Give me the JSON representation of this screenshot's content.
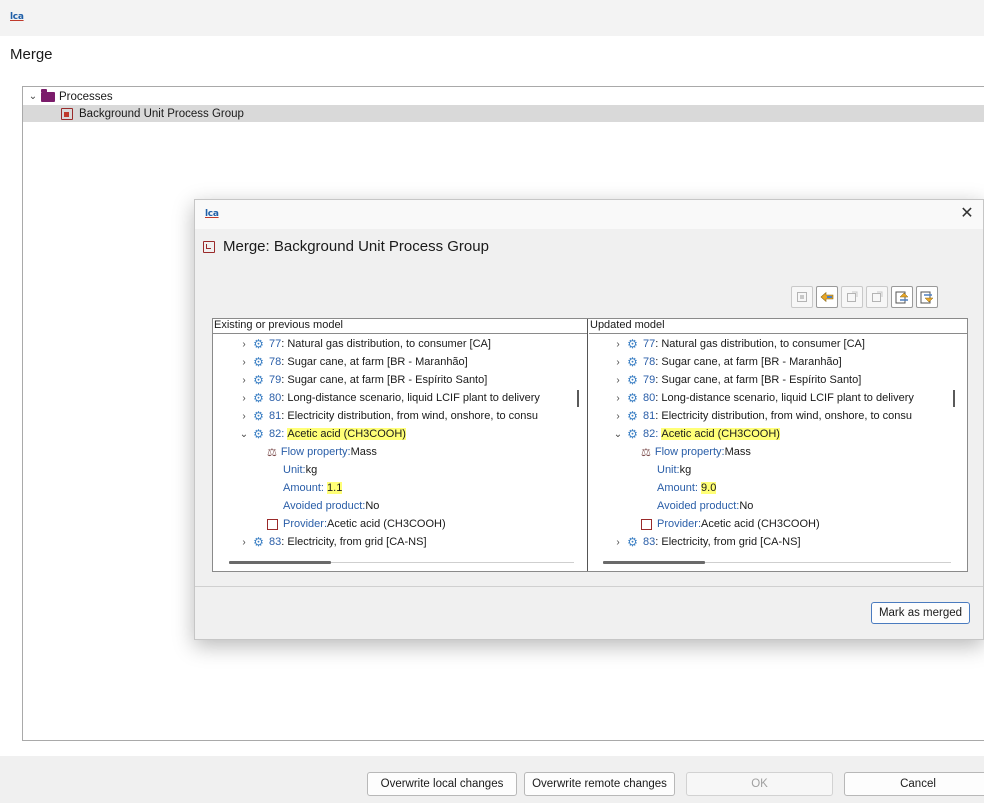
{
  "app": {
    "logo_text": "lca",
    "window_title": "Merge"
  },
  "tree": {
    "root_label": "Processes",
    "child_label": "Background Unit Process Group"
  },
  "dialog": {
    "logo_text": "lca",
    "close_glyph": "✕",
    "title": "Merge: Background Unit Process Group",
    "mark_as_merged_label": "Mark as merged",
    "toolbar_icons": [
      "copy-selection-icon",
      "copy-left-icon",
      "copy-all-right-icon",
      "copy-all-left-icon",
      "next-difference-icon",
      "previous-difference-icon"
    ]
  },
  "compare": {
    "left_header": "Existing or previous model",
    "right_header": "Updated model",
    "left": {
      "rows": [
        {
          "id": "77",
          "text": ": Natural gas distribution, to consumer [CA]"
        },
        {
          "id": "78",
          "text": ": Sugar cane, at farm [BR - Maranhão]"
        },
        {
          "id": "79",
          "text": ": Sugar cane, at farm [BR - Espírito Santo]"
        },
        {
          "id": "80",
          "text": ": Long-distance scenario, liquid LCIF plant to delivery"
        },
        {
          "id": "81",
          "text": ": Electricity distribution, from wind, onshore, to consu"
        },
        {
          "id": "82",
          "text": "Acetic acid (CH3COOH)"
        },
        {
          "id": "83",
          "text": ": Electricity, from grid [CA-NS]"
        }
      ],
      "flow_property_label": "Flow property:",
      "flow_property_value": " Mass",
      "unit_label": "Unit:",
      "unit_value": " kg",
      "amount_label": "Amount:",
      "amount_value": "1.1",
      "avoided_label": "Avoided product:",
      "avoided_value": " No",
      "provider_label": "Provider:",
      "provider_value": " Acetic acid (CH3COOH)"
    },
    "right": {
      "rows": [
        {
          "id": "77",
          "text": ": Natural gas distribution, to consumer [CA]"
        },
        {
          "id": "78",
          "text": ": Sugar cane, at farm [BR - Maranhão]"
        },
        {
          "id": "79",
          "text": ": Sugar cane, at farm [BR - Espírito Santo]"
        },
        {
          "id": "80",
          "text": ": Long-distance scenario, liquid LCIF plant to delivery"
        },
        {
          "id": "81",
          "text": ": Electricity distribution, from wind, onshore, to consu"
        },
        {
          "id": "82",
          "text": "Acetic acid (CH3COOH)"
        },
        {
          "id": "83",
          "text": ": Electricity, from grid [CA-NS]"
        }
      ],
      "flow_property_label": "Flow property:",
      "flow_property_value": " Mass",
      "unit_label": "Unit:",
      "unit_value": " kg",
      "amount_label": "Amount:",
      "amount_value": "9.0",
      "avoided_label": "Avoided product:",
      "avoided_value": " No",
      "provider_label": "Provider:",
      "provider_value": " Acetic acid (CH3COOH)"
    }
  },
  "buttons": {
    "overwrite_local": "Overwrite local changes",
    "overwrite_remote": "Overwrite remote changes",
    "ok": "OK",
    "cancel": "Cancel"
  },
  "colors": {
    "highlight": "#ffff77",
    "link_blue": "#2a5ea8",
    "brand_purple": "#7b1c6b"
  }
}
